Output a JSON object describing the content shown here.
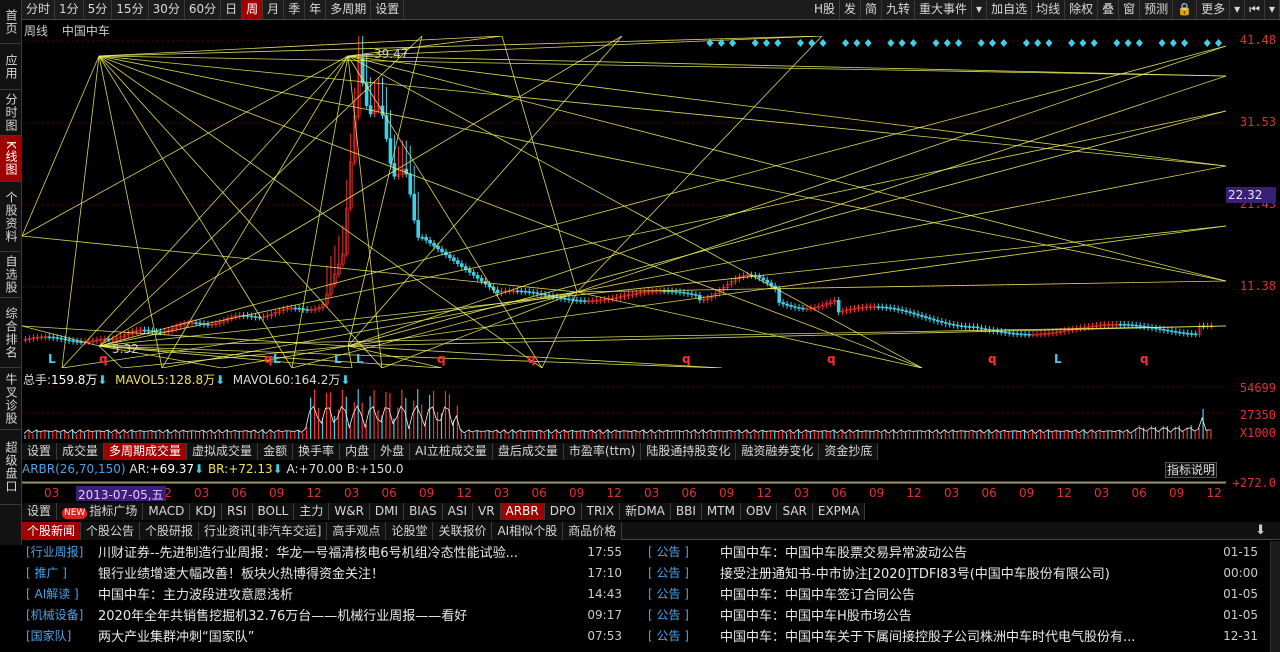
{
  "toolbar": {
    "left": [
      "分时",
      "1分",
      "5分",
      "15分",
      "30分",
      "60分",
      "日",
      "周",
      "月",
      "季",
      "年",
      "多周期",
      "设置"
    ],
    "active": "周",
    "right": [
      "H股",
      "发",
      "简",
      "九转",
      "重大事件",
      "▾",
      "加自选",
      "均线",
      "除权",
      "叠",
      "窗",
      "预测",
      "🔒",
      "更多",
      "▾",
      "⏮",
      "▾"
    ]
  },
  "sidebar": [
    "首页",
    "应用",
    "分时图",
    "K线图",
    "个股资料",
    "自选股",
    "综合排名",
    "牛叉诊股",
    "超级盘口"
  ],
  "sidebar_active": "K线图",
  "chart": {
    "period": "周线",
    "stock": "中国中车",
    "price_labels": [
      "41.48",
      "31.53",
      "21.43",
      "11.38"
    ],
    "current_price": "22.32",
    "high_marker": "39.47",
    "low_marker": "5.32",
    "bottom_marks": [
      "L",
      "q",
      "q",
      "L",
      "L",
      "L",
      "q",
      "q",
      "q",
      "q",
      "q",
      "L",
      "q"
    ],
    "colors": {
      "up": "#ff3030",
      "down": "#3fd0e8",
      "gann": "#f0f060",
      "accent": "#a00000"
    }
  },
  "volume": {
    "label_total": "总手:",
    "total": "159.8万",
    "label_ma5": "MAVOL5:",
    "ma5": "128.8万",
    "label_ma60": "MAVOL60:",
    "ma60": "164.2万",
    "axis": [
      "54699",
      "27350",
      "X1000"
    ]
  },
  "indicator_tabs_1": [
    "设置",
    "成交量",
    "多周期成交量",
    "虚拟成交量",
    "金额",
    "换手率",
    "内盘",
    "外盘",
    "AI立桩成交量",
    "盘后成交量",
    "市盈率(ttm)",
    "陆股通持股变化",
    "融资融券变化",
    "资金抄底"
  ],
  "indicator_tabs_1_active": "多周期成交量",
  "arbr": {
    "name": "ARBR(26,70,150)",
    "ar_label": "AR:",
    "ar": "+69.37",
    "br_label": "BR:",
    "br": "+72.13",
    "a_label": "A:",
    "a": "+70.00",
    "b_label": "B:",
    "b": "+150.0",
    "explain": "指标说明",
    "axis": "+272.0"
  },
  "dates": [
    "03",
    "06",
    "09",
    "12",
    "03",
    "06",
    "09",
    "12",
    "03",
    "06",
    "09",
    "12",
    "03",
    "06",
    "09",
    "12",
    "03",
    "06",
    "09",
    "12",
    "03",
    "06",
    "09",
    "12",
    "03",
    "06",
    "09",
    "12",
    "03",
    "06",
    "09",
    "12"
  ],
  "date_highlight": "2013-07-05,五",
  "indicator_tabs_2": [
    "设置",
    "指标广场",
    "MACD",
    "KDJ",
    "RSI",
    "BOLL",
    "主力",
    "W&R",
    "DMI",
    "BIAS",
    "ASI",
    "VR",
    "ARBR",
    "DPO",
    "TRIX",
    "新DMA",
    "BBI",
    "MTM",
    "OBV",
    "SAR",
    "EXPMA"
  ],
  "indicator_tabs_2_active": "ARBR",
  "news_tabs": [
    "个股新闻",
    "个股公告",
    "个股研报",
    "行业资讯[非汽车交运]",
    "高手观点",
    "论股堂",
    "关联报价",
    "AI相似个股",
    "商品价格"
  ],
  "news_tabs_active": "个股新闻",
  "news_left": [
    {
      "cat": "[行业周报]",
      "title": "川财证券--先进制造行业周报：华龙一号福清核电6号机组冷态性能试验...",
      "time": "17:55"
    },
    {
      "cat": "[  推广  ]",
      "title": "银行业绩增速大幅改善！板块火热博得资金关注！",
      "time": "17:10"
    },
    {
      "cat": "[ AI解读 ]",
      "title": "中国中车：主力波段进攻意愿浅析",
      "time": "14:43"
    },
    {
      "cat": "[机械设备]",
      "title": "2020年全年共销售挖掘机32.76万台——机械行业周报——看好",
      "time": "09:17"
    },
    {
      "cat": "[国家队]",
      "title": "两大产业集群冲刺“国家队”",
      "time": "07:53"
    }
  ],
  "news_right": [
    {
      "cat": "[  公告  ]",
      "title": "中国中车：中国中车股票交易异常波动公告",
      "time": "01-15"
    },
    {
      "cat": "[  公告  ]",
      "title": "接受注册通知书-中市协注[2020]TDFI83号(中国中车股份有限公司)",
      "time": "00:00"
    },
    {
      "cat": "[  公告  ]",
      "title": "中国中车：中国中车签订合同公告",
      "time": "01-05"
    },
    {
      "cat": "[  公告  ]",
      "title": "中国中车：中国中车H股市场公告",
      "time": "01-05"
    },
    {
      "cat": "[  公告  ]",
      "title": "中国中车：中国中车关于下属间接控股子公司株洲中车时代电气股份有...",
      "time": "12-31"
    }
  ]
}
